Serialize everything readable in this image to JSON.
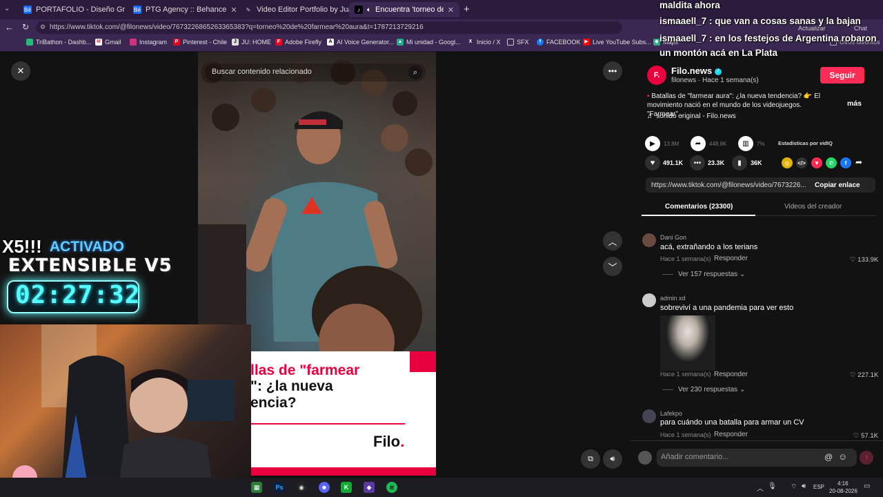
{
  "browser": {
    "tabs": [
      {
        "title": "PORTAFOLIO - Diseño Gráfico :: Be",
        "icon": "behance-icon"
      },
      {
        "title": "PTG Agency :: Behance",
        "icon": "behance-icon"
      },
      {
        "title": "Video Editor Portfolio by Juacoh",
        "icon": "pen-icon"
      },
      {
        "title": "Encuentra 'torneo de farmear",
        "icon": "tiktok-icon"
      }
    ],
    "url": "https://www.tiktok.com/@filonews/video/7673226865263365383?q=torneo%20de%20farmear%20aura&t=1787213729216",
    "update_label": "Actualizar",
    "chat_label": "Chat",
    "bookmarks": [
      "TriBathon - Dashb...",
      "Gmail",
      "Instagram",
      "Pinterest - Chile",
      "JU: HOME",
      "Adobe Firefly",
      "AI Voice Generator...",
      "Mi unidad - Googl...",
      "Inicio / X",
      "SFX",
      "FACEBOOK",
      "Live YouTube Subs...",
      "Maps"
    ],
    "other_bookmarks": "Otros favoritos"
  },
  "video": {
    "search_placeholder": "Buscar contenido relacionado",
    "card_title_line1": "llas de \"farmear",
    "card_title_line2": "\": ¿la nueva",
    "card_title_line3": "encia?",
    "card_logo": "Filo",
    "card_logo_dot": "."
  },
  "author": {
    "name": "Filo.news",
    "handle": "filonews",
    "posted": "Hace 1 semana(s)",
    "follow_label": "Seguir",
    "avatar_letter": "F.",
    "description": "Batallas de \"farmear aura\": ¿la nueva tendencia? 👉 El movimiento nació en el mundo de los videojuegos. \"Farmear\"...",
    "more_label": "más",
    "sound": "sonido original - Filo.news"
  },
  "stats": {
    "plays": "13.8M",
    "shares_views": "448.8K",
    "ratio": "7%",
    "vidiq_label": "Estadísticas por vidIQ",
    "likes": "491.1K",
    "comments": "23.3K",
    "saves": "36K"
  },
  "link": {
    "url": "https://www.tiktok.com/@filonews/video/7673226...",
    "copy_label": "Copiar enlace"
  },
  "tabs": {
    "comments": "Comentarios (23300)",
    "creator": "Videos del creador"
  },
  "comments": [
    {
      "user": "Dani Gon",
      "text": "acá, extrañando a los terians",
      "time": "Hace 1 semana(s)",
      "reply": "Responder",
      "likes": "133.9K",
      "more": "Ver 157 respuestas"
    },
    {
      "user": "admin xd",
      "text": "sobreviví a una pandemia para ver esto",
      "time": "Hace 1 semana(s)",
      "reply": "Responder",
      "likes": "227.1K",
      "more": "Ver 230 respuestas"
    },
    {
      "user": "Lafekpo",
      "text": "para cuándo una batalla para armar un CV",
      "time": "Hace 1 semana(s)",
      "reply": "Responder",
      "likes": "57.1K"
    }
  ],
  "comment_input_placeholder": "Añadir comentario...",
  "overlay": {
    "chat": [
      "maldita ahora",
      "ismaaell_7 : que van a cosas sanas y la bajan",
      "ismaaell_7 : en los festejos de Argentina robaron un montón acá en La Plata"
    ],
    "x5": "X5!!!",
    "activado": "ACTIVADO",
    "extensible": "EXTENSIBLE V5",
    "timer": "02:27:32"
  },
  "taskbar": {
    "lang": "ESP",
    "time": "4:16",
    "date": "20-08-2026"
  }
}
